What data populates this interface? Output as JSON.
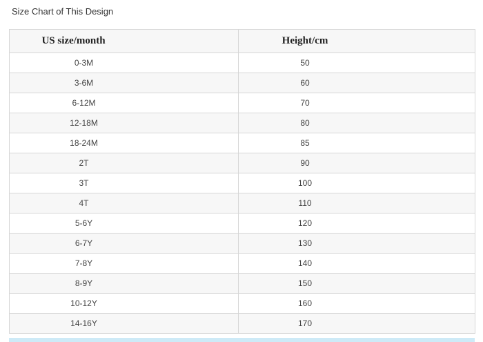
{
  "page": {
    "heading": "Size Chart of This Design"
  },
  "table": {
    "headers": [
      "US size/month",
      "Height/cm"
    ],
    "rows": [
      {
        "size": "0-3M",
        "height": "50"
      },
      {
        "size": "3-6M",
        "height": "60"
      },
      {
        "size": "6-12M",
        "height": "70"
      },
      {
        "size": "12-18M",
        "height": "80"
      },
      {
        "size": "18-24M",
        "height": "85"
      },
      {
        "size": "2T",
        "height": "90"
      },
      {
        "size": "3T",
        "height": "100"
      },
      {
        "size": "4T",
        "height": "110"
      },
      {
        "size": "5-6Y",
        "height": "120"
      },
      {
        "size": "6-7Y",
        "height": "130"
      },
      {
        "size": "7-8Y",
        "height": "140"
      },
      {
        "size": "8-9Y",
        "height": "150"
      },
      {
        "size": "10-12Y",
        "height": "160"
      },
      {
        "size": "14-16Y",
        "height": "170"
      }
    ]
  },
  "colors": {
    "border": "#d6d6d6",
    "header_bg": "#f7f7f7",
    "alt_row_bg": "#f7f7f7",
    "bottom_bar": "#cdeaf7"
  }
}
